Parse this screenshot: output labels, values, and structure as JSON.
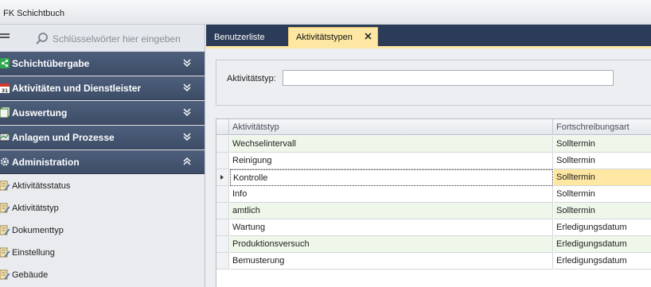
{
  "app": {
    "title": "FK Schichtbuch"
  },
  "sidebar": {
    "search_placeholder": "Schlüsselwörter hier eingeben",
    "groups": [
      {
        "label": "Schichtübergabe",
        "icon": "share-icon",
        "expanded": false
      },
      {
        "label": "Aktivitäten und Dienstleister",
        "icon": "calendar-icon",
        "expanded": false
      },
      {
        "label": "Auswertung",
        "icon": "report-icon",
        "expanded": false
      },
      {
        "label": "Anlagen und Prozesse",
        "icon": "monitor-icon",
        "expanded": false
      },
      {
        "label": "Administration",
        "icon": "gear-icon",
        "expanded": true
      }
    ],
    "admin_items": [
      {
        "label": "Aktivitätsstatus"
      },
      {
        "label": "Aktivitätstyp"
      },
      {
        "label": "Dokumenttyp"
      },
      {
        "label": "Einstellung"
      },
      {
        "label": "Gebäude"
      }
    ]
  },
  "tabs": [
    {
      "label": "Benutzerliste",
      "active": false
    },
    {
      "label": "Aktivitätstypen",
      "active": true
    }
  ],
  "filter": {
    "label": "Aktivitätstyp:",
    "value": ""
  },
  "grid": {
    "columns": [
      "Aktivitätstyp",
      "Fortschreibungsart"
    ],
    "rows": [
      {
        "typ": "Wechselintervall",
        "art": "Solltermin"
      },
      {
        "typ": "Reinigung",
        "art": "Solltermin"
      },
      {
        "typ": "Kontrolle",
        "art": "Solltermin"
      },
      {
        "typ": "Info",
        "art": "Solltermin"
      },
      {
        "typ": "amtlich",
        "art": "Solltermin"
      },
      {
        "typ": "Wartung",
        "art": "Erledigungsdatum"
      },
      {
        "typ": "Produktionsversuch",
        "art": "Erledigungsdatum"
      },
      {
        "typ": "Bemusterung",
        "art": "Erledigungsdatum"
      }
    ],
    "selected_row": 2
  },
  "colors": {
    "nav_group": "#46577a",
    "tab_bar": "#2c3c58",
    "active_tab": "#fde7a2",
    "alt_row": "#eef7ea"
  }
}
